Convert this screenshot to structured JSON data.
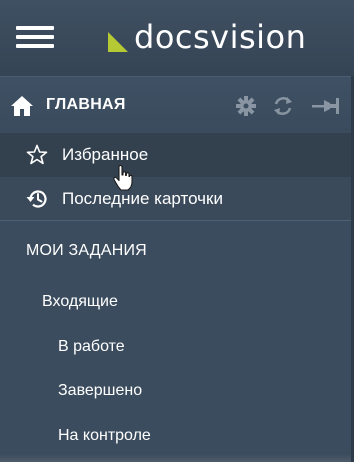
{
  "header": {
    "app_name": "docsvision"
  },
  "sidebar": {
    "home_label": "ГЛАВНАЯ",
    "items": [
      {
        "label": "Избранное",
        "icon": "star-icon"
      },
      {
        "label": "Последние карточки",
        "icon": "history-icon"
      }
    ],
    "section_title": "МОИ ЗАДАНИЯ",
    "tree": [
      {
        "label": "Входящие",
        "level": 1
      },
      {
        "label": "В работе",
        "level": 2
      },
      {
        "label": "Завершено",
        "level": 2
      },
      {
        "label": "На контроле",
        "level": 2
      }
    ]
  },
  "colors": {
    "header_bg": "#3f5062",
    "sidebar_bg": "#3b4c5e",
    "active_item_bg": "#33414f",
    "logo_accent": "#b5c934",
    "text": "#ffffff"
  }
}
